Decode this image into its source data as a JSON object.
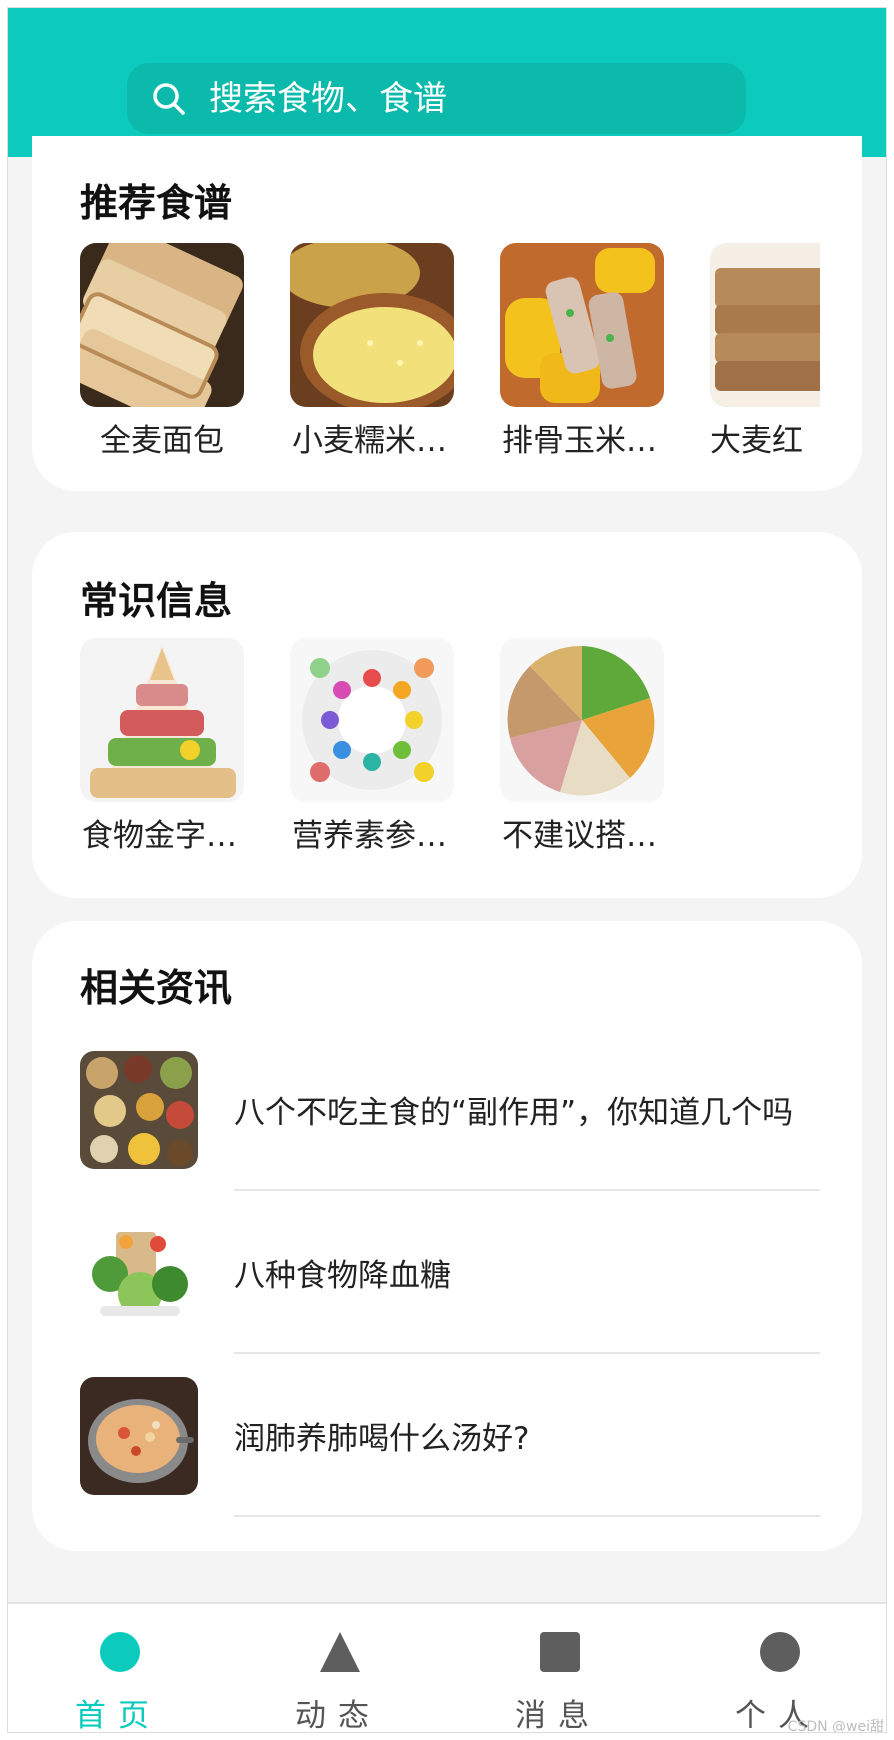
{
  "colors": {
    "accent": "#0ccbbc",
    "inactive_icon": "#5e5e5e",
    "background": "#f4f4f4"
  },
  "search": {
    "placeholder": "搜索食物、食谱",
    "icon": "search-icon"
  },
  "recipes": {
    "title": "推荐食谱",
    "items": [
      {
        "label": "全麦面包"
      },
      {
        "label": "小麦糯米…"
      },
      {
        "label": "排骨玉米…"
      },
      {
        "label": "大麦红"
      }
    ]
  },
  "knowledge": {
    "title": "常识信息",
    "items": [
      {
        "label": "食物金字…"
      },
      {
        "label": "营养素参…"
      },
      {
        "label": "不建议搭…"
      }
    ]
  },
  "news": {
    "title": "相关资讯",
    "items": [
      {
        "title": "八个不吃主食的“副作用”，你知道几个吗"
      },
      {
        "title": "八种食物降血糖"
      },
      {
        "title": "润肺养肺喝什么汤好?"
      }
    ]
  },
  "tabbar": {
    "tabs": [
      {
        "label": "首页",
        "icon": "circle-icon",
        "active": true
      },
      {
        "label": "动态",
        "icon": "triangle-icon",
        "active": false
      },
      {
        "label": "消息",
        "icon": "square-icon",
        "active": false
      },
      {
        "label": "个人",
        "icon": "circle-icon",
        "active": false
      }
    ]
  },
  "watermark": "CSDN @wei甜"
}
